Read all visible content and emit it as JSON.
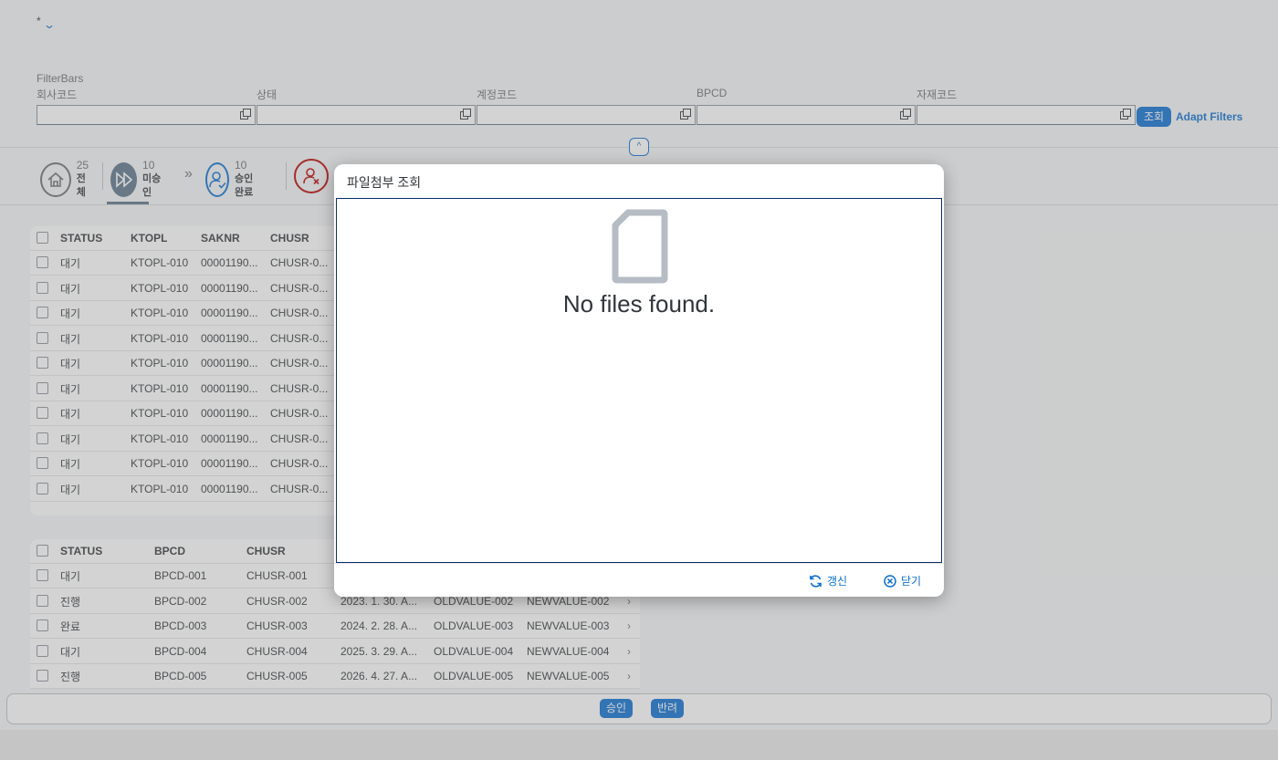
{
  "header": {
    "variant_label": "*",
    "filterbar_title": "FilterBars",
    "filters": [
      {
        "label": "회사코드",
        "value": ""
      },
      {
        "label": "상태",
        "value": ""
      },
      {
        "label": "계정코드",
        "value": ""
      },
      {
        "label": "BPCD",
        "value": ""
      },
      {
        "label": "자재코드",
        "value": ""
      }
    ],
    "go_button": "조회",
    "adapt_filters": "Adapt Filters"
  },
  "tabs": [
    {
      "count": "25",
      "label": "전체"
    },
    {
      "count": "10",
      "label": "미승인"
    },
    {
      "count": "10",
      "label": "승인완료"
    },
    {
      "count": "",
      "label": ""
    }
  ],
  "table1": {
    "columns": [
      "STATUS",
      "KTOPL",
      "SAKNR",
      "CHUSR"
    ],
    "rows": [
      [
        "대기",
        "KTOPL-010",
        "00001190...",
        "CHUSR-0..."
      ],
      [
        "대기",
        "KTOPL-010",
        "00001190...",
        "CHUSR-0..."
      ],
      [
        "대기",
        "KTOPL-010",
        "00001190...",
        "CHUSR-0..."
      ],
      [
        "대기",
        "KTOPL-010",
        "00001190...",
        "CHUSR-0..."
      ],
      [
        "대기",
        "KTOPL-010",
        "00001190...",
        "CHUSR-0..."
      ],
      [
        "대기",
        "KTOPL-010",
        "00001190...",
        "CHUSR-0..."
      ],
      [
        "대기",
        "KTOPL-010",
        "00001190...",
        "CHUSR-0..."
      ],
      [
        "대기",
        "KTOPL-010",
        "00001190...",
        "CHUSR-0..."
      ],
      [
        "대기",
        "KTOPL-010",
        "00001190...",
        "CHUSR-0..."
      ],
      [
        "대기",
        "KTOPL-010",
        "00001190...",
        "CHUSR-0..."
      ]
    ]
  },
  "table2": {
    "columns": [
      "STATUS",
      "BPCD",
      "CHUSR"
    ],
    "rows": [
      [
        "대기",
        "BPCD-001",
        "CHUSR-001",
        "",
        "",
        ""
      ],
      [
        "진행",
        "BPCD-002",
        "CHUSR-002",
        "2023. 1. 30. A...",
        "OLDVALUE-002",
        "NEWVALUE-002"
      ],
      [
        "완료",
        "BPCD-003",
        "CHUSR-003",
        "2024. 2. 28. A...",
        "OLDVALUE-003",
        "NEWVALUE-003"
      ],
      [
        "대기",
        "BPCD-004",
        "CHUSR-004",
        "2025. 3. 29. A...",
        "OLDVALUE-004",
        "NEWVALUE-004"
      ],
      [
        "진행",
        "BPCD-005",
        "CHUSR-005",
        "2026. 4. 27. A...",
        "OLDVALUE-005",
        "NEWVALUE-005"
      ]
    ]
  },
  "footer": {
    "approve": "승인",
    "reject": "반려"
  },
  "dialog": {
    "title": "파일첨부 조회",
    "message": "No files found.",
    "refresh": "갱신",
    "close": "닫기"
  },
  "colors": {
    "accent": "#0a6ed1",
    "negative": "#bb0000"
  }
}
